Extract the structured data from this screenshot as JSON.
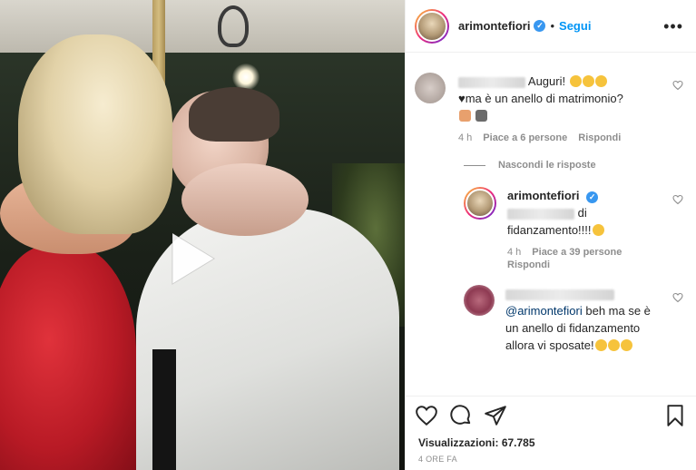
{
  "post": {
    "username": "arimontefiori",
    "follow_label": "Segui",
    "separator": "•",
    "more_label": "•••"
  },
  "comments": [
    {
      "text": "Auguri!",
      "text2": "♥ma è un anello di matrimonio?",
      "time": "4 h",
      "likes": "Piace a 6 persone",
      "reply": "Rispondi"
    }
  ],
  "hide_replies": "Nascondi le risposte",
  "replies": [
    {
      "username": "arimontefiori",
      "text_after_mention": "di",
      "text2": "fidanzamento!!!!",
      "time": "4 h",
      "likes": "Piace a 39 persone",
      "reply": "Rispondi"
    },
    {
      "mention": "@arimontefiori",
      "text": "beh ma se è un anello di fidanzamento allora vi sposate!"
    }
  ],
  "stats": {
    "views_label": "Visualizzazioni:",
    "views_value": "67.785",
    "time_ago": "4 ORE FA"
  },
  "colors": {
    "link": "#0095f6",
    "verified": "#3897f0",
    "muted": "#8e8e8e",
    "text": "#262626"
  }
}
